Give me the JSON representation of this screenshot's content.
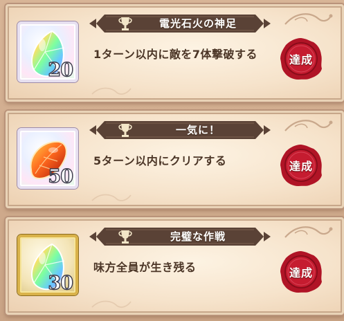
{
  "achievements": [
    {
      "title": "電光石火の神足",
      "description": "1ターン以内に敵を7体撃破する",
      "reward_count": "20",
      "reward_icon": "rainbow-gem-icon",
      "status": "達成"
    },
    {
      "title": "一気に！",
      "description": "5ターン以内にクリアする",
      "reward_count": "50",
      "reward_icon": "fire-gem-icon",
      "status": "達成"
    },
    {
      "title": "完璧な作戦",
      "description": "味方全員が生き残る",
      "reward_count": "30",
      "reward_icon": "rainbow-gem-icon",
      "status": "達成"
    }
  ],
  "colors": {
    "ribbon": "#5a4236",
    "seal": "#b01426",
    "card": "#f6e3cb",
    "gold": "#d9b24a"
  }
}
